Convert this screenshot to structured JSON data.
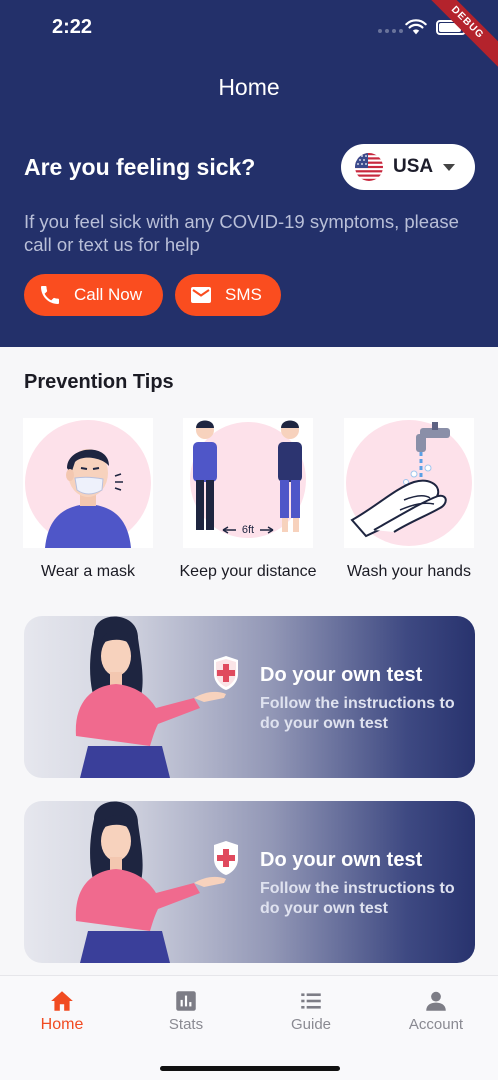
{
  "status_bar": {
    "time": "2:22",
    "debug_label": "DEBUG"
  },
  "header": {
    "title": "Home",
    "heading": "Are you feeling sick?",
    "country": {
      "label": "USA",
      "flag_icon": "us-flag-icon"
    },
    "help_text": "If you feel sick with any COVID-19 symptoms, please call or text us for help",
    "buttons": {
      "call_label": "Call Now",
      "sms_label": "SMS"
    }
  },
  "prevention": {
    "title": "Prevention Tips",
    "tips": [
      {
        "label": "Wear a mask",
        "icon": "wear-mask-illustration"
      },
      {
        "label": "Keep your distance",
        "icon": "distance-illustration",
        "distance_text": "6ft"
      },
      {
        "label": "Wash your hands",
        "icon": "wash-hands-illustration"
      }
    ]
  },
  "cards": [
    {
      "title": "Do your own test",
      "subtitle": "Follow the instructions to do your own test"
    },
    {
      "title": "Do your own test",
      "subtitle": "Follow the instructions to do your own test"
    }
  ],
  "bottom_nav": {
    "items": [
      {
        "label": "Home",
        "icon": "home-icon",
        "active": true
      },
      {
        "label": "Stats",
        "icon": "stats-icon",
        "active": false
      },
      {
        "label": "Guide",
        "icon": "list-icon",
        "active": false
      },
      {
        "label": "Account",
        "icon": "person-icon",
        "active": false
      }
    ]
  },
  "colors": {
    "primary_dark": "#23306a",
    "accent": "#fa4d1f",
    "pink": "#fde1ea"
  }
}
